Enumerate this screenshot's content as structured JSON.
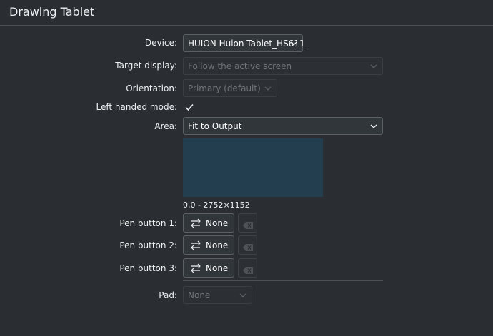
{
  "header": {
    "title": "Drawing Tablet"
  },
  "device": {
    "label": "Device:",
    "value": "HUION Huion Tablet_HS611"
  },
  "target_display": {
    "label": "Target display:",
    "value": "Follow the active screen"
  },
  "orientation": {
    "label": "Orientation:",
    "value": "Primary (default)"
  },
  "left_handed": {
    "label": "Left handed mode:",
    "checked": true
  },
  "area": {
    "label": "Area:",
    "value": "Fit to Output",
    "range_text": "0,0 - 2752×1152"
  },
  "pen_buttons": [
    {
      "label": "Pen button 1:",
      "value": "None"
    },
    {
      "label": "Pen button 2:",
      "value": "None"
    },
    {
      "label": "Pen button 3:",
      "value": "None"
    }
  ],
  "pad": {
    "label": "Pad:",
    "value": "None"
  },
  "colors": {
    "accent": "#3daee9",
    "area_fill": "#223e4f",
    "background": "#2a2e32"
  }
}
